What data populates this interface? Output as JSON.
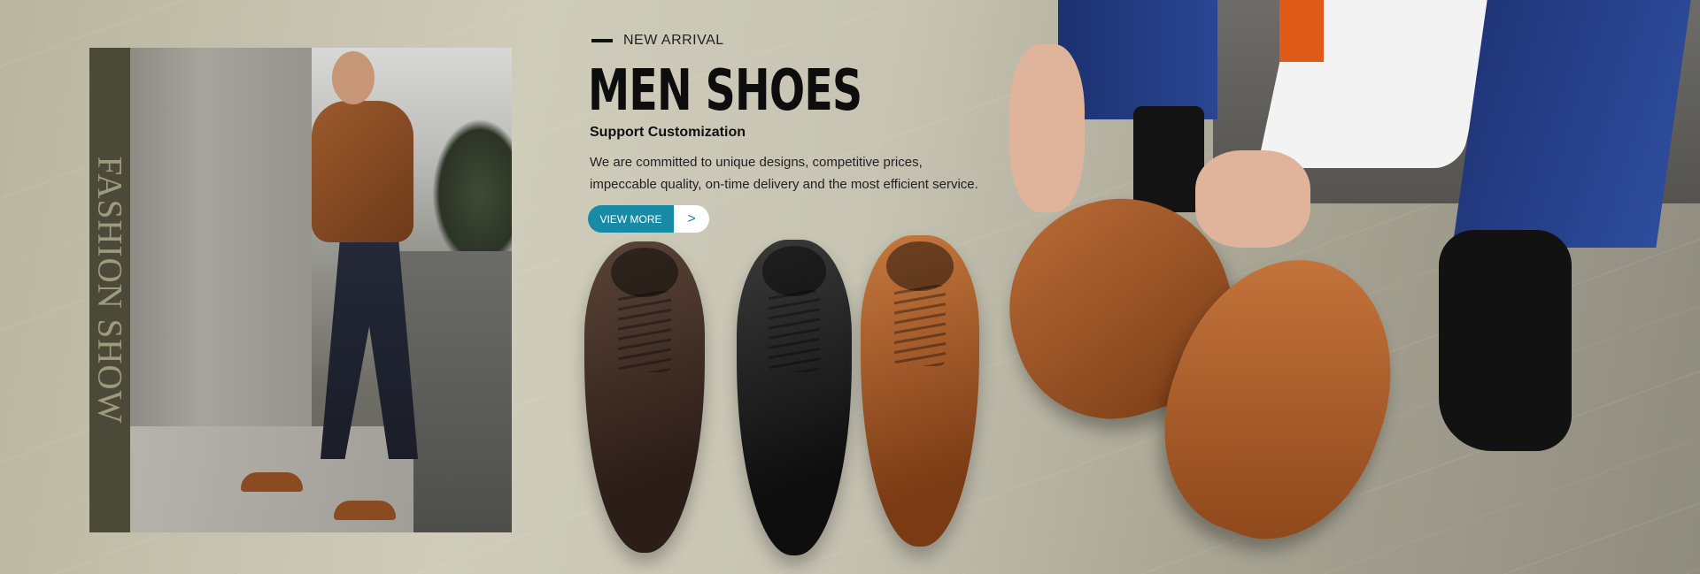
{
  "banner": {
    "side_text": "FASHION SHOW",
    "eyebrow": "NEW ARRIVAL",
    "headline": "MEN SHOES",
    "subheading": "Support Customization",
    "description_line1": "We are committed to unique designs, competitive prices,",
    "description_line2": "impeccable quality, on-time delivery and the most efficient service.",
    "cta_label": "VIEW MORE",
    "cta_arrow": ">"
  },
  "colors": {
    "accent": "#178aa6",
    "headline": "#0d0d0d",
    "side_strip": "#4b4a38"
  },
  "products": [
    {
      "name": "brown oxford shoe",
      "color": "dark brown"
    },
    {
      "name": "black oxford shoe",
      "color": "black"
    },
    {
      "name": "tan oxford shoe",
      "color": "tan"
    }
  ]
}
